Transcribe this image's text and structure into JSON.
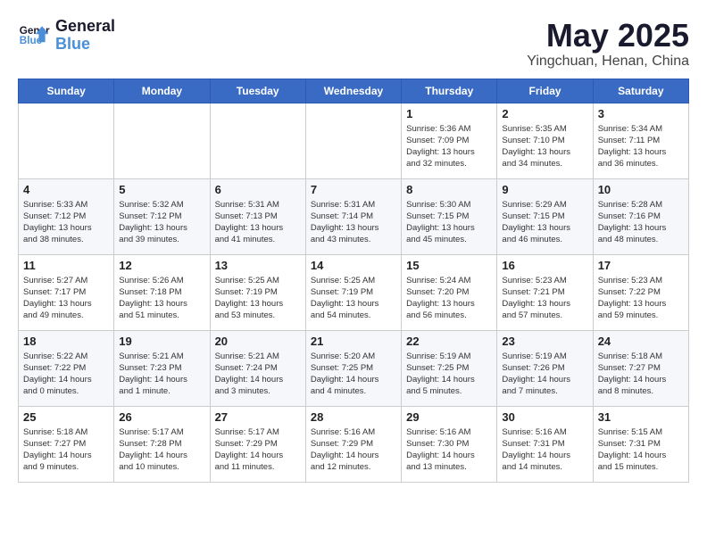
{
  "logo": {
    "line1": "General",
    "line2": "Blue"
  },
  "title": "May 2025",
  "subtitle": "Yingchuan, Henan, China",
  "weekdays": [
    "Sunday",
    "Monday",
    "Tuesday",
    "Wednesday",
    "Thursday",
    "Friday",
    "Saturday"
  ],
  "weeks": [
    [
      {
        "day": "",
        "info": ""
      },
      {
        "day": "",
        "info": ""
      },
      {
        "day": "",
        "info": ""
      },
      {
        "day": "",
        "info": ""
      },
      {
        "day": "1",
        "info": "Sunrise: 5:36 AM\nSunset: 7:09 PM\nDaylight: 13 hours\nand 32 minutes."
      },
      {
        "day": "2",
        "info": "Sunrise: 5:35 AM\nSunset: 7:10 PM\nDaylight: 13 hours\nand 34 minutes."
      },
      {
        "day": "3",
        "info": "Sunrise: 5:34 AM\nSunset: 7:11 PM\nDaylight: 13 hours\nand 36 minutes."
      }
    ],
    [
      {
        "day": "4",
        "info": "Sunrise: 5:33 AM\nSunset: 7:12 PM\nDaylight: 13 hours\nand 38 minutes."
      },
      {
        "day": "5",
        "info": "Sunrise: 5:32 AM\nSunset: 7:12 PM\nDaylight: 13 hours\nand 39 minutes."
      },
      {
        "day": "6",
        "info": "Sunrise: 5:31 AM\nSunset: 7:13 PM\nDaylight: 13 hours\nand 41 minutes."
      },
      {
        "day": "7",
        "info": "Sunrise: 5:31 AM\nSunset: 7:14 PM\nDaylight: 13 hours\nand 43 minutes."
      },
      {
        "day": "8",
        "info": "Sunrise: 5:30 AM\nSunset: 7:15 PM\nDaylight: 13 hours\nand 45 minutes."
      },
      {
        "day": "9",
        "info": "Sunrise: 5:29 AM\nSunset: 7:15 PM\nDaylight: 13 hours\nand 46 minutes."
      },
      {
        "day": "10",
        "info": "Sunrise: 5:28 AM\nSunset: 7:16 PM\nDaylight: 13 hours\nand 48 minutes."
      }
    ],
    [
      {
        "day": "11",
        "info": "Sunrise: 5:27 AM\nSunset: 7:17 PM\nDaylight: 13 hours\nand 49 minutes."
      },
      {
        "day": "12",
        "info": "Sunrise: 5:26 AM\nSunset: 7:18 PM\nDaylight: 13 hours\nand 51 minutes."
      },
      {
        "day": "13",
        "info": "Sunrise: 5:25 AM\nSunset: 7:19 PM\nDaylight: 13 hours\nand 53 minutes."
      },
      {
        "day": "14",
        "info": "Sunrise: 5:25 AM\nSunset: 7:19 PM\nDaylight: 13 hours\nand 54 minutes."
      },
      {
        "day": "15",
        "info": "Sunrise: 5:24 AM\nSunset: 7:20 PM\nDaylight: 13 hours\nand 56 minutes."
      },
      {
        "day": "16",
        "info": "Sunrise: 5:23 AM\nSunset: 7:21 PM\nDaylight: 13 hours\nand 57 minutes."
      },
      {
        "day": "17",
        "info": "Sunrise: 5:23 AM\nSunset: 7:22 PM\nDaylight: 13 hours\nand 59 minutes."
      }
    ],
    [
      {
        "day": "18",
        "info": "Sunrise: 5:22 AM\nSunset: 7:22 PM\nDaylight: 14 hours\nand 0 minutes."
      },
      {
        "day": "19",
        "info": "Sunrise: 5:21 AM\nSunset: 7:23 PM\nDaylight: 14 hours\nand 1 minute."
      },
      {
        "day": "20",
        "info": "Sunrise: 5:21 AM\nSunset: 7:24 PM\nDaylight: 14 hours\nand 3 minutes."
      },
      {
        "day": "21",
        "info": "Sunrise: 5:20 AM\nSunset: 7:25 PM\nDaylight: 14 hours\nand 4 minutes."
      },
      {
        "day": "22",
        "info": "Sunrise: 5:19 AM\nSunset: 7:25 PM\nDaylight: 14 hours\nand 5 minutes."
      },
      {
        "day": "23",
        "info": "Sunrise: 5:19 AM\nSunset: 7:26 PM\nDaylight: 14 hours\nand 7 minutes."
      },
      {
        "day": "24",
        "info": "Sunrise: 5:18 AM\nSunset: 7:27 PM\nDaylight: 14 hours\nand 8 minutes."
      }
    ],
    [
      {
        "day": "25",
        "info": "Sunrise: 5:18 AM\nSunset: 7:27 PM\nDaylight: 14 hours\nand 9 minutes."
      },
      {
        "day": "26",
        "info": "Sunrise: 5:17 AM\nSunset: 7:28 PM\nDaylight: 14 hours\nand 10 minutes."
      },
      {
        "day": "27",
        "info": "Sunrise: 5:17 AM\nSunset: 7:29 PM\nDaylight: 14 hours\nand 11 minutes."
      },
      {
        "day": "28",
        "info": "Sunrise: 5:16 AM\nSunset: 7:29 PM\nDaylight: 14 hours\nand 12 minutes."
      },
      {
        "day": "29",
        "info": "Sunrise: 5:16 AM\nSunset: 7:30 PM\nDaylight: 14 hours\nand 13 minutes."
      },
      {
        "day": "30",
        "info": "Sunrise: 5:16 AM\nSunset: 7:31 PM\nDaylight: 14 hours\nand 14 minutes."
      },
      {
        "day": "31",
        "info": "Sunrise: 5:15 AM\nSunset: 7:31 PM\nDaylight: 14 hours\nand 15 minutes."
      }
    ]
  ]
}
